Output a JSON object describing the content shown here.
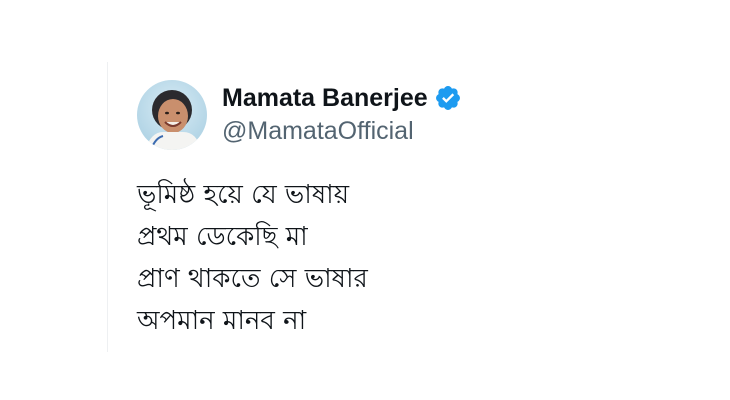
{
  "tweet": {
    "author": {
      "display_name": "Mamata Banerjee",
      "handle": "@MamataOfficial",
      "verified": true,
      "badge_icon": "verified-check-icon",
      "badge_color": "#1d9bf0"
    },
    "text_lines": [
      "ভূমিষ্ঠ হয়ে যে ভাষায়",
      "প্রথম ডেকেছি মা",
      "প্রাণ থাকতে সে ভাষার",
      "অপমান মানব না"
    ]
  },
  "colors": {
    "name": "#0f1419",
    "handle": "#536471",
    "text": "#0f1419"
  }
}
